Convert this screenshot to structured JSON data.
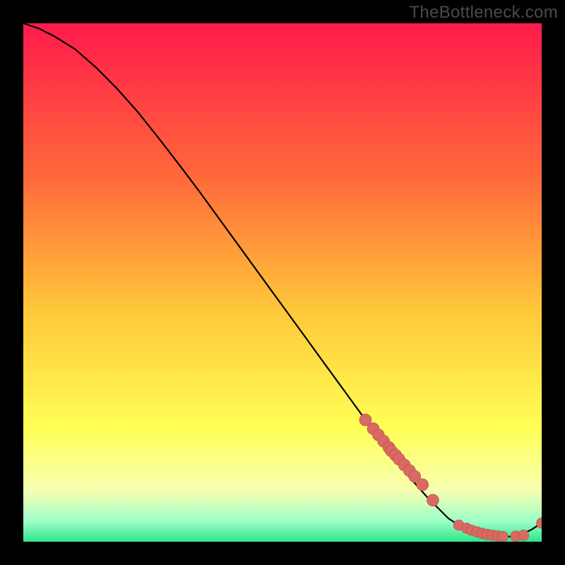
{
  "watermark": "TheBottleneck.com",
  "colors": {
    "grad_top": "#ff1a4b",
    "grad_mid1": "#ff6a3a",
    "grad_mid2": "#ffc63a",
    "grad_mid3": "#ffff55",
    "grad_bottom1": "#f7ffb0",
    "grad_bottom2": "#9effc8",
    "grad_bottom3": "#2ee68a",
    "curve": "#000000",
    "marker_fill": "#d86a63",
    "marker_stroke": "#b94a45"
  },
  "chart_data": {
    "type": "line",
    "title": "",
    "xlabel": "",
    "ylabel": "",
    "xlim": [
      0,
      100
    ],
    "ylim": [
      0,
      100
    ],
    "curve": {
      "x": [
        0,
        3,
        6,
        10,
        14,
        18,
        22,
        26,
        30,
        34,
        38,
        42,
        46,
        50,
        54,
        58,
        62,
        66,
        70,
        74,
        78,
        82,
        84,
        86,
        88,
        90,
        92,
        94,
        96,
        98,
        100
      ],
      "y": [
        100,
        99,
        97.5,
        95,
        91.5,
        87.5,
        83,
        78,
        72.8,
        67.5,
        62,
        56.5,
        51,
        45.5,
        40,
        34.5,
        29,
        23.5,
        18,
        13,
        8.5,
        4.5,
        3.2,
        2.2,
        1.6,
        1.2,
        1.0,
        1.0,
        1.4,
        2.3,
        3.6
      ]
    },
    "markers_fuzzy": {
      "x": [
        66,
        67.5,
        68.5,
        69.5,
        70.5,
        71,
        71.8,
        72.5,
        73.5,
        74.5,
        75.5,
        77,
        79
      ],
      "y": [
        23.5,
        21.8,
        20.6,
        19.4,
        18.2,
        17.5,
        16.7,
        15.9,
        14.8,
        13.7,
        12.6,
        11.0,
        8.0
      ]
    },
    "markers_bottom": {
      "x": [
        84,
        85.5,
        86.5,
        87.5,
        88.5,
        89.5,
        90.5,
        91.5,
        92.5,
        95,
        96.5,
        100
      ],
      "y": [
        3.2,
        2.6,
        2.2,
        1.9,
        1.6,
        1.4,
        1.25,
        1.1,
        1.0,
        1.05,
        1.25,
        3.6
      ]
    }
  }
}
